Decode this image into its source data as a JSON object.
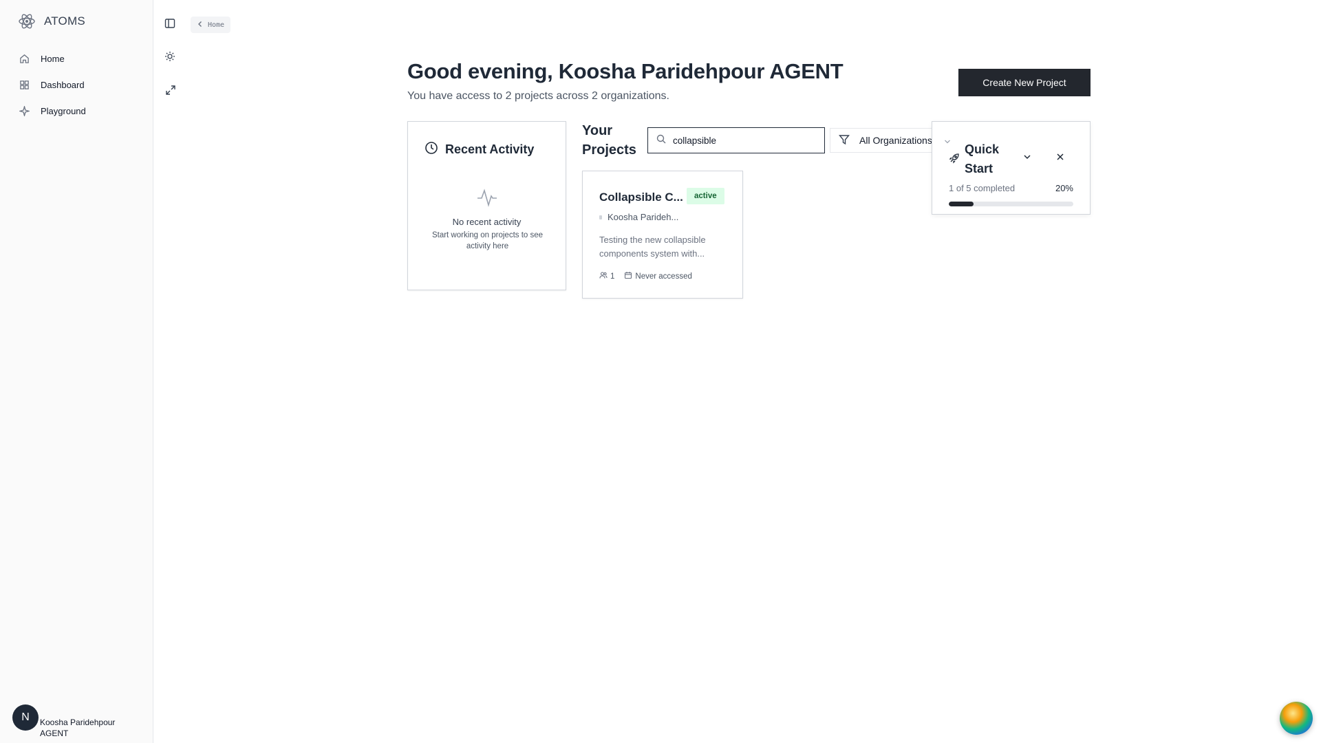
{
  "brand": {
    "name": "ATOMS"
  },
  "sidebar": {
    "items": [
      {
        "label": "Home",
        "icon": "home-icon"
      },
      {
        "label": "Dashboard",
        "icon": "dashboard-icon"
      },
      {
        "label": "Playground",
        "icon": "sparkle-icon"
      }
    ]
  },
  "user": {
    "initial": "N",
    "name": "Koosha Paridehpour AGENT"
  },
  "breadcrumb": {
    "label": "Home"
  },
  "header": {
    "greeting": "Good evening, Koosha Paridehpour AGENT",
    "subtext": "You have access to 2 projects across 2 organizations.",
    "create_button": "Create New Project"
  },
  "recent_activity": {
    "title": "Recent Activity",
    "empty_title": "No recent activity",
    "empty_hint": "Start working on projects to see activity here"
  },
  "projects": {
    "title": "Your Projects",
    "search_value": "collapsible",
    "filter_label": "All Organizations",
    "items": [
      {
        "name": "Collapsible C...",
        "status": "active",
        "owner": "Koosha Parideh...",
        "description": "Testing the new collapsible components system with...",
        "members": "1",
        "last_accessed": "Never accessed"
      }
    ]
  },
  "quick_start": {
    "title": "Quick Start",
    "progress_text": "1 of 5 completed",
    "percent_label": "20%",
    "progress_fraction": 0.2
  },
  "colors": {
    "primary": "#23272e",
    "active_badge_bg": "#dcfce7",
    "active_badge_text": "#166534"
  }
}
